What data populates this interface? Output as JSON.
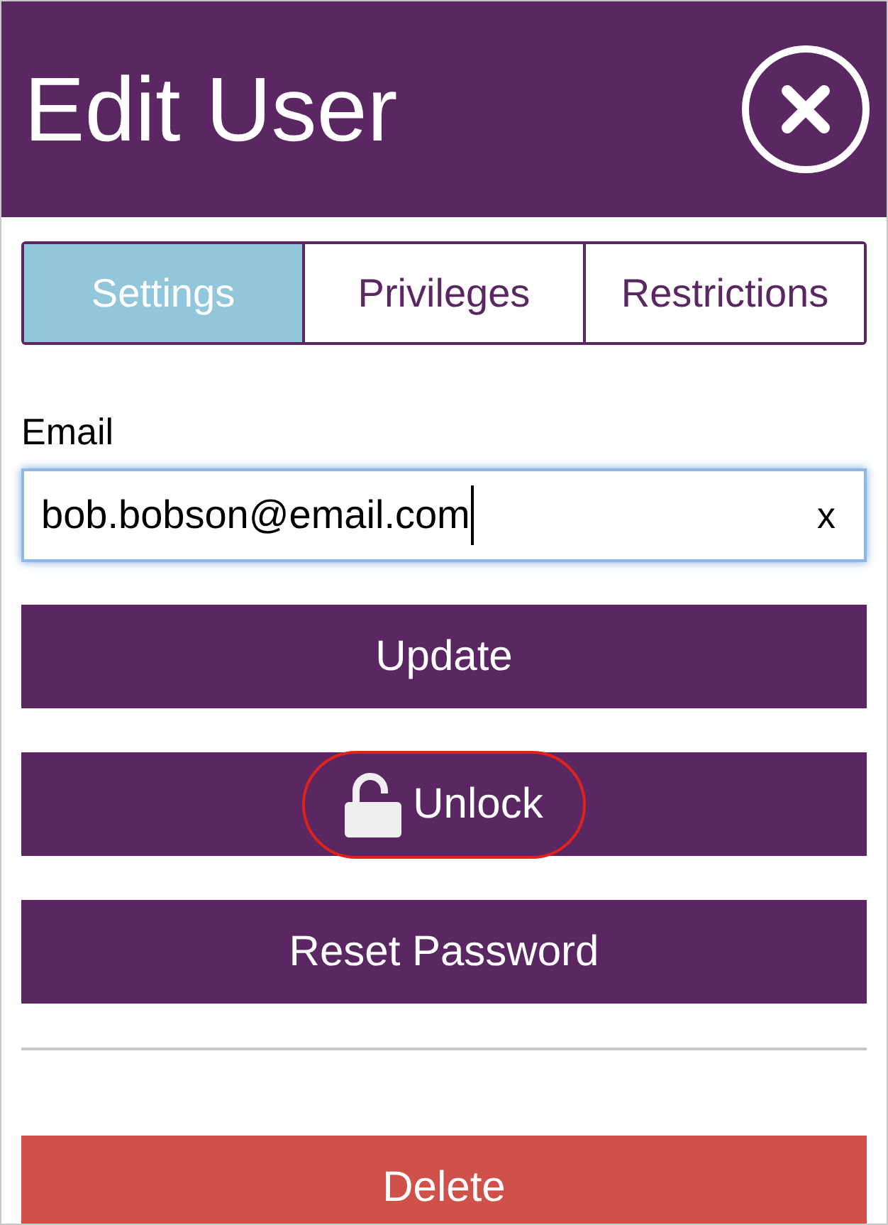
{
  "window": {
    "title": "Edit User"
  },
  "tabs": [
    {
      "label": "Settings",
      "selected": true
    },
    {
      "label": "Privileges",
      "selected": false
    },
    {
      "label": "Restrictions",
      "selected": false
    }
  ],
  "email": {
    "label": "Email",
    "value": "bob.bobson@email.com",
    "clear": "x",
    "focused": true
  },
  "buttons": [
    {
      "label": "Update",
      "kind": "primary",
      "highlighted": false
    },
    {
      "label": "Unlock",
      "kind": "unlock",
      "highlighted": true
    },
    {
      "label": "Reset Password",
      "kind": "primary",
      "highlighted": false
    }
  ],
  "danger_button": {
    "label": "Delete",
    "kind": "danger"
  }
}
